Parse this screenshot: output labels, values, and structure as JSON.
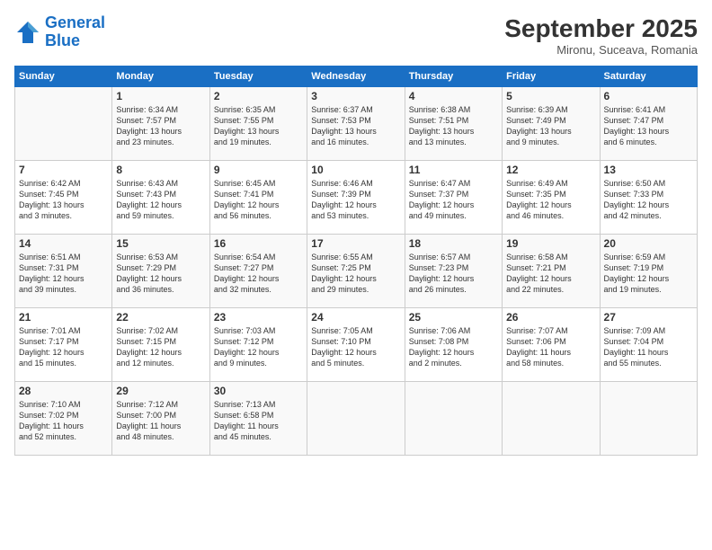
{
  "header": {
    "logo_line1": "General",
    "logo_line2": "Blue",
    "month_title": "September 2025",
    "location": "Mironu, Suceava, Romania"
  },
  "weekdays": [
    "Sunday",
    "Monday",
    "Tuesday",
    "Wednesday",
    "Thursday",
    "Friday",
    "Saturday"
  ],
  "weeks": [
    [
      {
        "day": "",
        "info": ""
      },
      {
        "day": "1",
        "info": "Sunrise: 6:34 AM\nSunset: 7:57 PM\nDaylight: 13 hours\nand 23 minutes."
      },
      {
        "day": "2",
        "info": "Sunrise: 6:35 AM\nSunset: 7:55 PM\nDaylight: 13 hours\nand 19 minutes."
      },
      {
        "day": "3",
        "info": "Sunrise: 6:37 AM\nSunset: 7:53 PM\nDaylight: 13 hours\nand 16 minutes."
      },
      {
        "day": "4",
        "info": "Sunrise: 6:38 AM\nSunset: 7:51 PM\nDaylight: 13 hours\nand 13 minutes."
      },
      {
        "day": "5",
        "info": "Sunrise: 6:39 AM\nSunset: 7:49 PM\nDaylight: 13 hours\nand 9 minutes."
      },
      {
        "day": "6",
        "info": "Sunrise: 6:41 AM\nSunset: 7:47 PM\nDaylight: 13 hours\nand 6 minutes."
      }
    ],
    [
      {
        "day": "7",
        "info": "Sunrise: 6:42 AM\nSunset: 7:45 PM\nDaylight: 13 hours\nand 3 minutes."
      },
      {
        "day": "8",
        "info": "Sunrise: 6:43 AM\nSunset: 7:43 PM\nDaylight: 12 hours\nand 59 minutes."
      },
      {
        "day": "9",
        "info": "Sunrise: 6:45 AM\nSunset: 7:41 PM\nDaylight: 12 hours\nand 56 minutes."
      },
      {
        "day": "10",
        "info": "Sunrise: 6:46 AM\nSunset: 7:39 PM\nDaylight: 12 hours\nand 53 minutes."
      },
      {
        "day": "11",
        "info": "Sunrise: 6:47 AM\nSunset: 7:37 PM\nDaylight: 12 hours\nand 49 minutes."
      },
      {
        "day": "12",
        "info": "Sunrise: 6:49 AM\nSunset: 7:35 PM\nDaylight: 12 hours\nand 46 minutes."
      },
      {
        "day": "13",
        "info": "Sunrise: 6:50 AM\nSunset: 7:33 PM\nDaylight: 12 hours\nand 42 minutes."
      }
    ],
    [
      {
        "day": "14",
        "info": "Sunrise: 6:51 AM\nSunset: 7:31 PM\nDaylight: 12 hours\nand 39 minutes."
      },
      {
        "day": "15",
        "info": "Sunrise: 6:53 AM\nSunset: 7:29 PM\nDaylight: 12 hours\nand 36 minutes."
      },
      {
        "day": "16",
        "info": "Sunrise: 6:54 AM\nSunset: 7:27 PM\nDaylight: 12 hours\nand 32 minutes."
      },
      {
        "day": "17",
        "info": "Sunrise: 6:55 AM\nSunset: 7:25 PM\nDaylight: 12 hours\nand 29 minutes."
      },
      {
        "day": "18",
        "info": "Sunrise: 6:57 AM\nSunset: 7:23 PM\nDaylight: 12 hours\nand 26 minutes."
      },
      {
        "day": "19",
        "info": "Sunrise: 6:58 AM\nSunset: 7:21 PM\nDaylight: 12 hours\nand 22 minutes."
      },
      {
        "day": "20",
        "info": "Sunrise: 6:59 AM\nSunset: 7:19 PM\nDaylight: 12 hours\nand 19 minutes."
      }
    ],
    [
      {
        "day": "21",
        "info": "Sunrise: 7:01 AM\nSunset: 7:17 PM\nDaylight: 12 hours\nand 15 minutes."
      },
      {
        "day": "22",
        "info": "Sunrise: 7:02 AM\nSunset: 7:15 PM\nDaylight: 12 hours\nand 12 minutes."
      },
      {
        "day": "23",
        "info": "Sunrise: 7:03 AM\nSunset: 7:12 PM\nDaylight: 12 hours\nand 9 minutes."
      },
      {
        "day": "24",
        "info": "Sunrise: 7:05 AM\nSunset: 7:10 PM\nDaylight: 12 hours\nand 5 minutes."
      },
      {
        "day": "25",
        "info": "Sunrise: 7:06 AM\nSunset: 7:08 PM\nDaylight: 12 hours\nand 2 minutes."
      },
      {
        "day": "26",
        "info": "Sunrise: 7:07 AM\nSunset: 7:06 PM\nDaylight: 11 hours\nand 58 minutes."
      },
      {
        "day": "27",
        "info": "Sunrise: 7:09 AM\nSunset: 7:04 PM\nDaylight: 11 hours\nand 55 minutes."
      }
    ],
    [
      {
        "day": "28",
        "info": "Sunrise: 7:10 AM\nSunset: 7:02 PM\nDaylight: 11 hours\nand 52 minutes."
      },
      {
        "day": "29",
        "info": "Sunrise: 7:12 AM\nSunset: 7:00 PM\nDaylight: 11 hours\nand 48 minutes."
      },
      {
        "day": "30",
        "info": "Sunrise: 7:13 AM\nSunset: 6:58 PM\nDaylight: 11 hours\nand 45 minutes."
      },
      {
        "day": "",
        "info": ""
      },
      {
        "day": "",
        "info": ""
      },
      {
        "day": "",
        "info": ""
      },
      {
        "day": "",
        "info": ""
      }
    ]
  ]
}
